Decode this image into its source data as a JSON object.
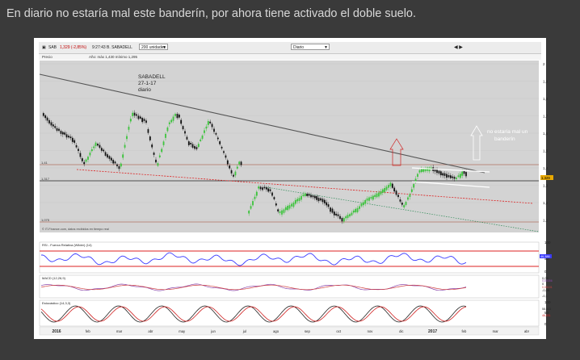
{
  "caption": "En diario no estaría mal este banderín, por ahora tiene activado el doble suelo.",
  "toolbar": {
    "ticker": "SAB",
    "price": "1,329 (-2,85%)",
    "time": "9:27:43",
    "name": "B. SABADELL",
    "units": "200 unidades",
    "period": "Diario"
  },
  "price_panel": {
    "label": "Precio",
    "stats": "Año: máx 1,430 mínimo 1,295",
    "annotation_ticker": "SABADELL",
    "annotation_date": "27-1-17",
    "annotation_period": "diario",
    "annotation_note_1": "no estaría mal un",
    "annotation_note_2": "banderín",
    "level_high": "1,41",
    "level_mid": "1,317",
    "level_low": "1,075",
    "last_price": "1,329",
    "y_ticks": [
      "2",
      "1,9",
      "1,8",
      "1,7",
      "1,6",
      "1,5",
      "1,4",
      "1,3",
      "1,2",
      "1,1"
    ],
    "source": "© IT-Finance.com, datos recibidos en tiempo real"
  },
  "rsi_panel": {
    "label": "RSI - Fuerza Relativa (Wilder) (14)",
    "y_ticks": [
      "100",
      "50",
      "0"
    ],
    "last": "46,386"
  },
  "macd_panel": {
    "label": "MACD (12,26,9)",
    "y_ticks": [
      "0,05",
      "0",
      "-0,05",
      "-0,1"
    ],
    "last_1": "0,00356",
    "last_2": "0,00101"
  },
  "stoch_panel": {
    "label": "Estocástico (14,3,3)",
    "y_ticks": [
      "100",
      "50",
      "0"
    ],
    "last_1": "58,613",
    "last_2": "46,831"
  },
  "x_axis": [
    "2016",
    "feb",
    "mar",
    "abr",
    "may",
    "jun",
    "jul",
    "ago",
    "sep",
    "oct",
    "nov",
    "dic",
    "2017",
    "feb",
    "mar",
    "abr"
  ],
  "colors": {
    "candle_up": "#2db52d",
    "candle_down": "#1a1a1a",
    "rsi_line": "#3a3aff",
    "support_line": "#dd2222",
    "trend_line": "#555555"
  }
}
